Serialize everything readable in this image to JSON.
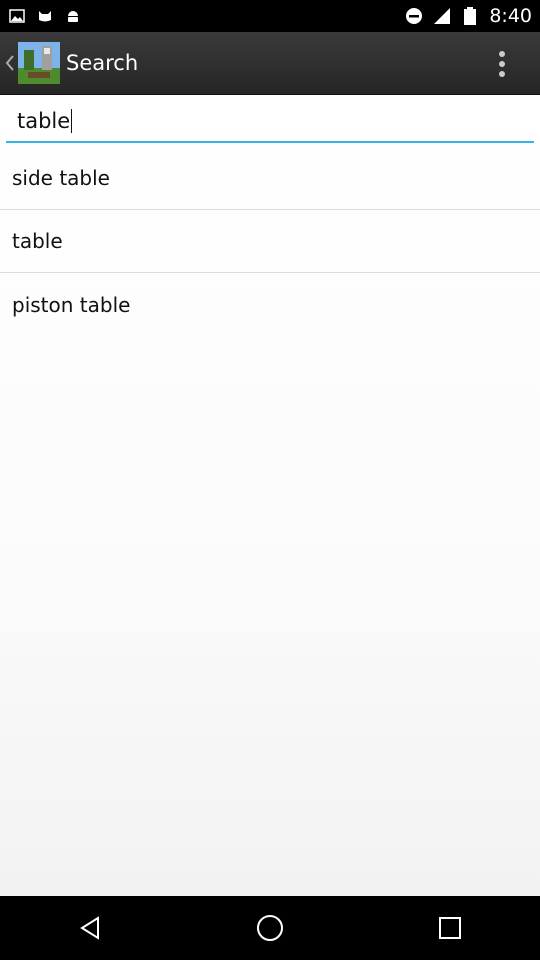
{
  "status_bar": {
    "time": "8:40",
    "icons": [
      "image-icon",
      "cat-icon",
      "android-icon",
      "do-not-disturb-icon",
      "signal-icon",
      "battery-icon"
    ]
  },
  "action_bar": {
    "title": "Search",
    "icons": [
      "back-chevron-icon",
      "app-icon",
      "overflow-menu-icon"
    ]
  },
  "search": {
    "value": "table"
  },
  "results": [
    {
      "label": "side table"
    },
    {
      "label": "table"
    },
    {
      "label": "piston table"
    }
  ],
  "nav_bar": {
    "icons": [
      "back-icon",
      "home-icon",
      "recents-icon"
    ]
  },
  "colors": {
    "accent": "#33b5e5",
    "action_bar": "#2d2d2d"
  }
}
